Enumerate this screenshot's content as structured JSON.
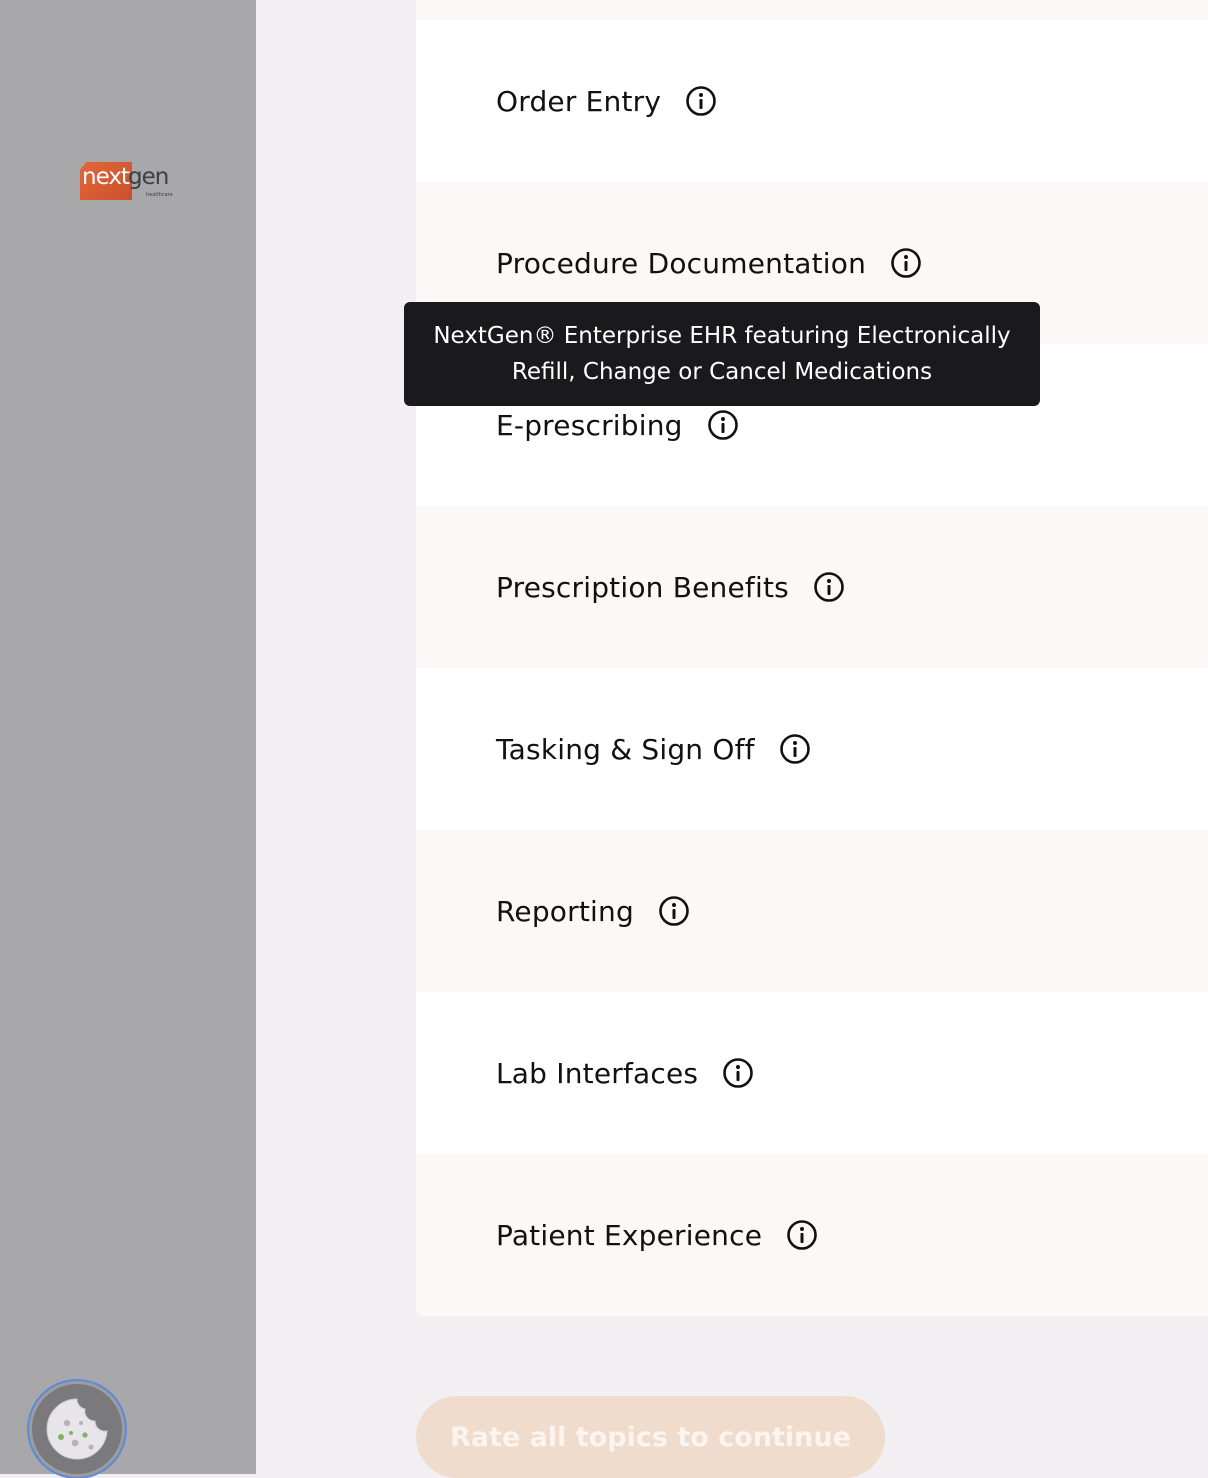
{
  "brand": {
    "logo_next": "next",
    "logo_gen": "gen",
    "logo_sub": "healthcare",
    "accent": "#e2673a"
  },
  "topics": [
    {
      "label": "Order Entry",
      "icon": "info-icon"
    },
    {
      "label": "Procedure Documentation",
      "icon": "info-icon"
    },
    {
      "label": "E-prescribing",
      "icon": "info-icon"
    },
    {
      "label": "Prescription Benefits",
      "icon": "info-icon"
    },
    {
      "label": "Tasking & Sign Off",
      "icon": "info-icon"
    },
    {
      "label": "Reporting",
      "icon": "info-icon"
    },
    {
      "label": "Lab Interfaces",
      "icon": "info-icon"
    },
    {
      "label": "Patient Experience",
      "icon": "info-icon"
    }
  ],
  "tooltip": {
    "text": "NextGen® Enterprise EHR featuring Electronically Refill, Change or Cancel Medications"
  },
  "cta": {
    "label": "Rate all topics to continue",
    "state": "disabled"
  },
  "cookie": {
    "icon": "cookie-icon"
  }
}
